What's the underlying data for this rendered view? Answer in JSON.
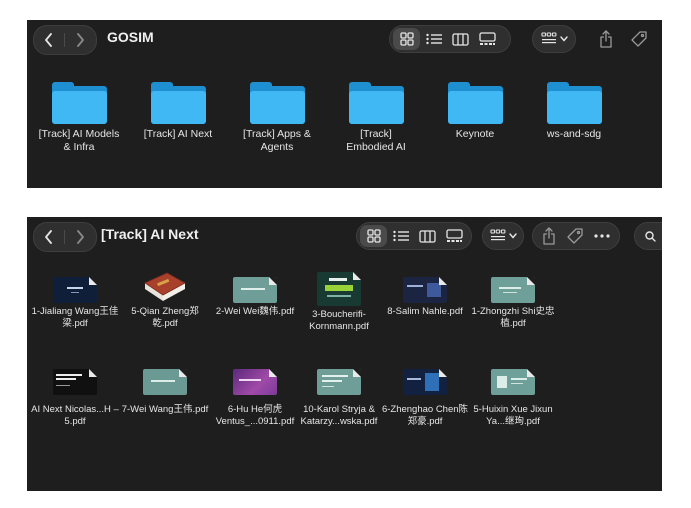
{
  "window1": {
    "title": "GOSIM",
    "folders": [
      {
        "label": "[Track] AI Models & Infra"
      },
      {
        "label": "[Track] AI Next"
      },
      {
        "label": "[Track] Apps & Agents"
      },
      {
        "label": "[Track] Embodied AI"
      },
      {
        "label": "Keynote"
      },
      {
        "label": "ws-and-sdg"
      }
    ]
  },
  "window2": {
    "title": "[Track] AI Next",
    "files": [
      {
        "label": "1-Jialiang Wang王佳梁.pdf"
      },
      {
        "label": "5-Qian Zheng郑乾.pdf"
      },
      {
        "label": "2-Wei Wei魏伟.pdf"
      },
      {
        "label": "3-Boucherifi-Kornmann.pdf"
      },
      {
        "label": "8-Salim Nahle.pdf"
      },
      {
        "label": "1-Zhongzhi Shi史忠植.pdf"
      },
      {
        "label": "AI Next Nicolas...H – 5.pdf"
      },
      {
        "label": "7-Wei Wang王伟.pdf"
      },
      {
        "label": "6-Hu He何虎Ventus_...0911.pdf"
      },
      {
        "label": "10-Karol Stryja & Katarzy...wska.pdf"
      },
      {
        "label": "6-Zhenghao Chen陈郑豪.pdf"
      },
      {
        "label": "5-Huixin Xue Jixun Ya...继珣.pdf"
      }
    ]
  },
  "colors": {
    "window_bg": "#1e1e1e",
    "folder_front": "#3fb8f3",
    "folder_back": "#1e8fd0",
    "toolbar_button_bg": "#2f2f2f"
  },
  "icons": [
    "chevron-left-icon",
    "chevron-right-icon",
    "icon-view-icon",
    "list-view-icon",
    "column-view-icon",
    "gallery-view-icon",
    "group-by-icon",
    "share-icon",
    "tag-icon",
    "more-icon",
    "search-icon"
  ]
}
